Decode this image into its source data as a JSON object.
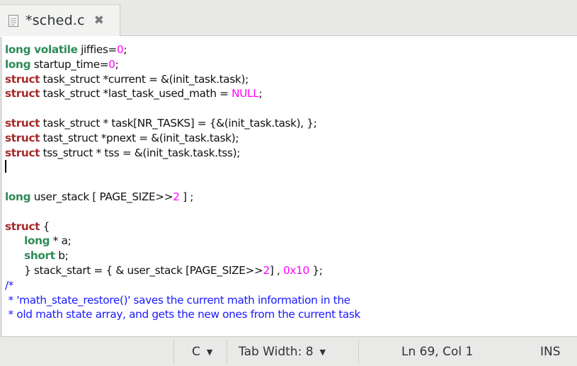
{
  "tab": {
    "title": "*sched.c",
    "close_glyph": "✖",
    "doc_icon": "document-icon",
    "close_icon": "close-icon"
  },
  "code_lines": [
    [
      {
        "t": "long volatile",
        "c": "type"
      },
      {
        "t": " jiffies=",
        "c": ""
      },
      {
        "t": "0",
        "c": "num"
      },
      {
        "t": ";",
        "c": ""
      }
    ],
    [
      {
        "t": "long",
        "c": "type"
      },
      {
        "t": " startup_time=",
        "c": ""
      },
      {
        "t": "0",
        "c": "num"
      },
      {
        "t": ";",
        "c": ""
      }
    ],
    [
      {
        "t": "struct",
        "c": "kw"
      },
      {
        "t": " task_struct *current = &(init_task.task);",
        "c": ""
      }
    ],
    [
      {
        "t": "struct",
        "c": "kw"
      },
      {
        "t": " task_struct *last_task_used_math = ",
        "c": ""
      },
      {
        "t": "NULL",
        "c": "num"
      },
      {
        "t": ";",
        "c": ""
      }
    ],
    [],
    [
      {
        "t": "struct",
        "c": "kw"
      },
      {
        "t": " task_struct * task[NR_TASKS] = {&(init_task.task), };",
        "c": ""
      }
    ],
    [
      {
        "t": "struct",
        "c": "kw"
      },
      {
        "t": " tast_struct *pnext = &(init_task.task);",
        "c": ""
      }
    ],
    [
      {
        "t": "struct",
        "c": "kw"
      },
      {
        "t": " tss_struct * tss = &(init_task.task.tss);",
        "c": ""
      }
    ],
    [
      {
        "caret": true
      }
    ],
    [],
    [
      {
        "t": "long",
        "c": "type"
      },
      {
        "t": " user_stack [ PAGE_SIZE>>",
        "c": ""
      },
      {
        "t": "2",
        "c": "num"
      },
      {
        "t": " ] ;",
        "c": ""
      }
    ],
    [],
    [
      {
        "t": "struct",
        "c": "kw"
      },
      {
        "t": " {",
        "c": ""
      }
    ],
    [
      {
        "t": "      ",
        "c": ""
      },
      {
        "t": "long",
        "c": "type"
      },
      {
        "t": " * a;",
        "c": ""
      }
    ],
    [
      {
        "t": "      ",
        "c": ""
      },
      {
        "t": "short",
        "c": "type"
      },
      {
        "t": " b;",
        "c": ""
      }
    ],
    [
      {
        "t": "      } stack_start = { & user_stack [PAGE_SIZE>>",
        "c": ""
      },
      {
        "t": "2",
        "c": "num"
      },
      {
        "t": "] , ",
        "c": ""
      },
      {
        "t": "0x10",
        "c": "num"
      },
      {
        "t": " };",
        "c": ""
      }
    ],
    [
      {
        "t": "/*",
        "c": "cmt"
      }
    ],
    [
      {
        "t": " * 'math_state_restore()' saves the current math information in the",
        "c": "cmt"
      }
    ],
    [
      {
        "t": " * old math state array, and gets the new ones from the current task",
        "c": "cmt"
      }
    ]
  ],
  "statusbar": {
    "language": "C",
    "tab_width": "Tab Width:  8",
    "position": "Ln 69, Col 1",
    "mode": "INS",
    "dropdown_glyph": "▼"
  },
  "colors": {
    "type": "#2e8b57",
    "keyword": "#a52a2a",
    "number": "#ff00ff",
    "comment": "#1a1aff"
  }
}
